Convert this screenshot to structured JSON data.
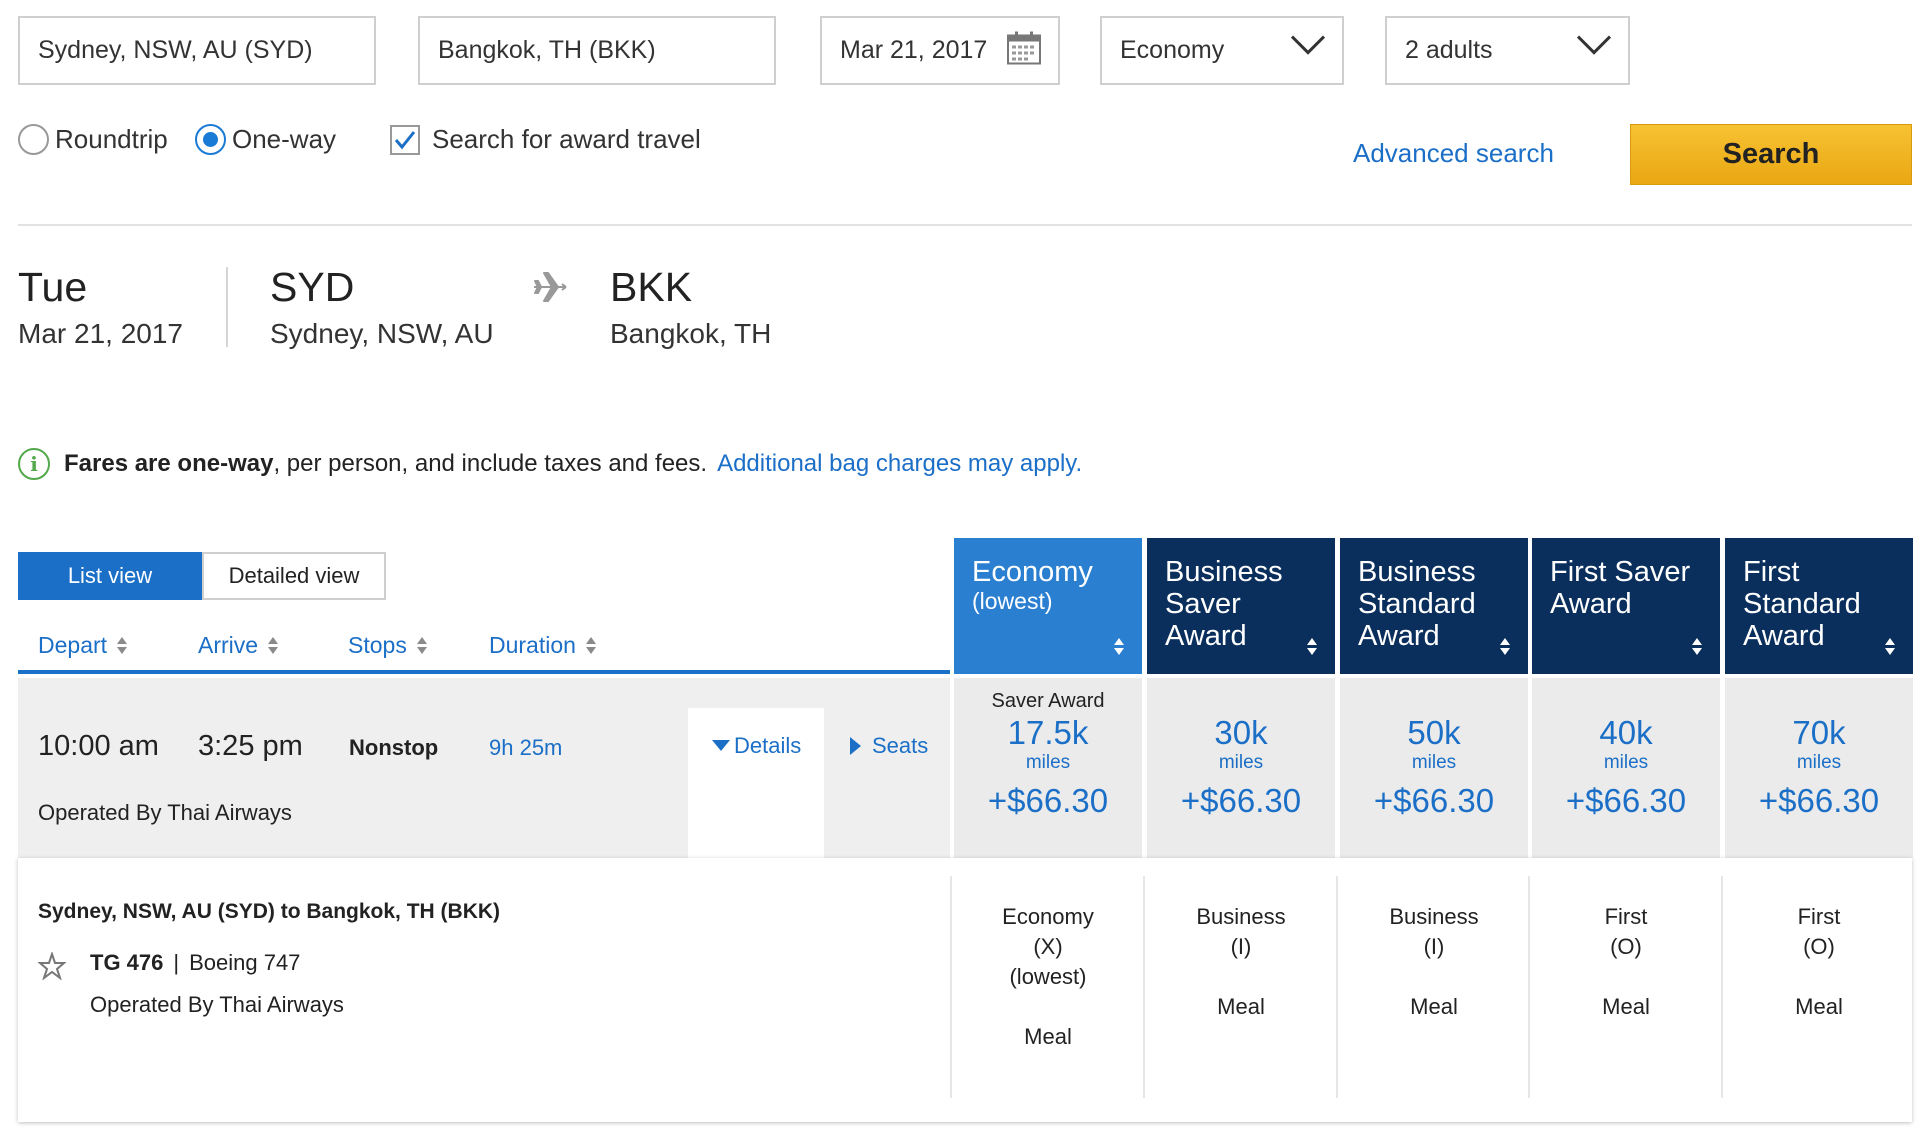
{
  "search": {
    "origin": "Sydney, NSW, AU (SYD)",
    "destination": "Bangkok, TH (BKK)",
    "date": "Mar 21, 2017",
    "cabin": "Economy",
    "passengers": "2 adults",
    "trip_roundtrip": "Roundtrip",
    "trip_oneway": "One-way",
    "trip_selected": "One-way",
    "award_label": "Search for award travel",
    "award_checked": true,
    "advanced_link": "Advanced search",
    "search_button": "Search"
  },
  "route": {
    "day": "Tue",
    "date": "Mar 21, 2017",
    "from_code": "SYD",
    "from_city": "Sydney, NSW, AU",
    "to_code": "BKK",
    "to_city": "Bangkok, TH"
  },
  "notice": {
    "bold": "Fares are one-way",
    "text": ", per person, and include taxes and fees.",
    "link": "Additional bag charges may apply."
  },
  "views": {
    "list": "List view",
    "detailed": "Detailed view",
    "active": "List view"
  },
  "sort": {
    "depart": "Depart",
    "arrive": "Arrive",
    "stops": "Stops",
    "duration": "Duration"
  },
  "fare_columns": [
    {
      "line1": "Economy",
      "line2": "(lowest)",
      "line3": ""
    },
    {
      "line1": "Business",
      "line2": "Saver",
      "line3": "Award"
    },
    {
      "line1": "Business",
      "line2": "Standard",
      "line3": "Award"
    },
    {
      "line1": "First Saver",
      "line2": "Award",
      "line3": ""
    },
    {
      "line1": "First",
      "line2": "Standard",
      "line3": "Award"
    }
  ],
  "flight": {
    "depart": "10:00 am",
    "arrive": "3:25 pm",
    "stops": "Nonstop",
    "duration": "9h 25m",
    "operated": "Operated By Thai Airways",
    "details_link": "Details",
    "seats_link": "Seats",
    "fares": [
      {
        "label": "Saver Award",
        "miles": "17.5k",
        "unit": "miles",
        "tax": "+$66.30"
      },
      {
        "label": "",
        "miles": "30k",
        "unit": "miles",
        "tax": "+$66.30"
      },
      {
        "label": "",
        "miles": "50k",
        "unit": "miles",
        "tax": "+$66.30"
      },
      {
        "label": "",
        "miles": "40k",
        "unit": "miles",
        "tax": "+$66.30"
      },
      {
        "label": "",
        "miles": "70k",
        "unit": "miles",
        "tax": "+$66.30"
      }
    ]
  },
  "segment": {
    "route": "Sydney, NSW, AU (SYD) to Bangkok, TH (BKK)",
    "flight_no": "TG 476",
    "separator": "|",
    "aircraft": "Boeing 747",
    "operated": "Operated By Thai Airways",
    "classes": [
      {
        "cabin": "Economy",
        "code": "(X)",
        "note": "(lowest)",
        "meal": "Meal"
      },
      {
        "cabin": "Business",
        "code": "(I)",
        "note": "",
        "meal": "Meal"
      },
      {
        "cabin": "Business",
        "code": "(I)",
        "note": "",
        "meal": "Meal"
      },
      {
        "cabin": "First",
        "code": "(O)",
        "note": "",
        "meal": "Meal"
      },
      {
        "cabin": "First",
        "code": "(O)",
        "note": "",
        "meal": "Meal"
      }
    ]
  },
  "colors": {
    "brand_blue": "#1b6fc7",
    "economy_header": "#2a7fd1",
    "premium_header": "#0a2f5c",
    "search_button": "#f2b722",
    "info_green": "#53a84b"
  }
}
